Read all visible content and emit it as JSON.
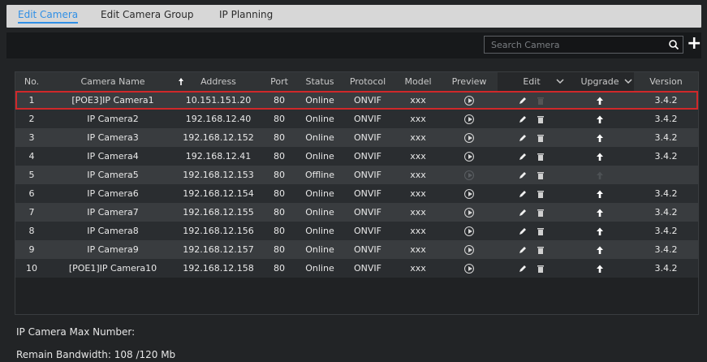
{
  "tabs": [
    {
      "label": "Edit Camera",
      "active": true
    },
    {
      "label": "Edit Camera Group",
      "active": false
    },
    {
      "label": "IP Planning",
      "active": false
    }
  ],
  "search": {
    "placeholder": "Search Camera"
  },
  "columns": {
    "no": "No.",
    "name": "Camera Name",
    "address": "Address",
    "port": "Port",
    "status": "Status",
    "protocol": "Protocol",
    "model": "Model",
    "preview": "Preview",
    "edit": "Edit",
    "upgrade": "Upgrade",
    "version": "Version"
  },
  "rows": [
    {
      "no": "1",
      "name": "[POE3]IP Camera1",
      "address": "10.151.151.20",
      "port": "80",
      "status": "Online",
      "protocol": "ONVIF",
      "model": "xxx",
      "version": "3.4.2",
      "selected": true
    },
    {
      "no": "2",
      "name": "IP Camera2",
      "address": "192.168.12.40",
      "port": "80",
      "status": "Online",
      "protocol": "ONVIF",
      "model": "xxx",
      "version": "3.4.2"
    },
    {
      "no": "3",
      "name": "IP Camera3",
      "address": "192.168.12.152",
      "port": "80",
      "status": "Online",
      "protocol": "ONVIF",
      "model": "xxx",
      "version": "3.4.2"
    },
    {
      "no": "4",
      "name": "IP Camera4",
      "address": "192.168.12.41",
      "port": "80",
      "status": "Online",
      "protocol": "ONVIF",
      "model": "xxx",
      "version": "3.4.2"
    },
    {
      "no": "5",
      "name": "IP Camera5",
      "address": "192.168.12.153",
      "port": "80",
      "status": "Offline",
      "protocol": "ONVIF",
      "model": "xxx",
      "version": ""
    },
    {
      "no": "6",
      "name": "IP Camera6",
      "address": "192.168.12.154",
      "port": "80",
      "status": "Online",
      "protocol": "ONVIF",
      "model": "xxx",
      "version": "3.4.2"
    },
    {
      "no": "7",
      "name": "IP Camera7",
      "address": "192.168.12.155",
      "port": "80",
      "status": "Online",
      "protocol": "ONVIF",
      "model": "xxx",
      "version": "3.4.2"
    },
    {
      "no": "8",
      "name": "IP Camera8",
      "address": "192.168.12.156",
      "port": "80",
      "status": "Online",
      "protocol": "ONVIF",
      "model": "xxx",
      "version": "3.4.2"
    },
    {
      "no": "9",
      "name": "IP Camera9",
      "address": "192.168.12.157",
      "port": "80",
      "status": "Online",
      "protocol": "ONVIF",
      "model": "xxx",
      "version": "3.4.2"
    },
    {
      "no": "10",
      "name": "[POE1]IP Camera10",
      "address": "192.168.12.158",
      "port": "80",
      "status": "Online",
      "protocol": "ONVIF",
      "model": "xxx",
      "version": "3.4.2"
    }
  ],
  "footer": {
    "max_number_label": "IP Camera Max Number:",
    "bandwidth_label": "Remain Bandwidth: 108 /120 Mb"
  },
  "icons": {
    "search": "search-icon",
    "add": "plus-icon",
    "sort": "arrow-up-icon",
    "dropdown": "chevron-down-icon",
    "preview": "play-icon",
    "edit": "pencil-icon",
    "delete": "trash-icon",
    "upgrade": "upload-arrow-icon"
  },
  "colors": {
    "accent": "#2f8fe6",
    "selection": "#d0282a",
    "row_odd": "#393c3f",
    "row_even": "#2a2d30"
  }
}
